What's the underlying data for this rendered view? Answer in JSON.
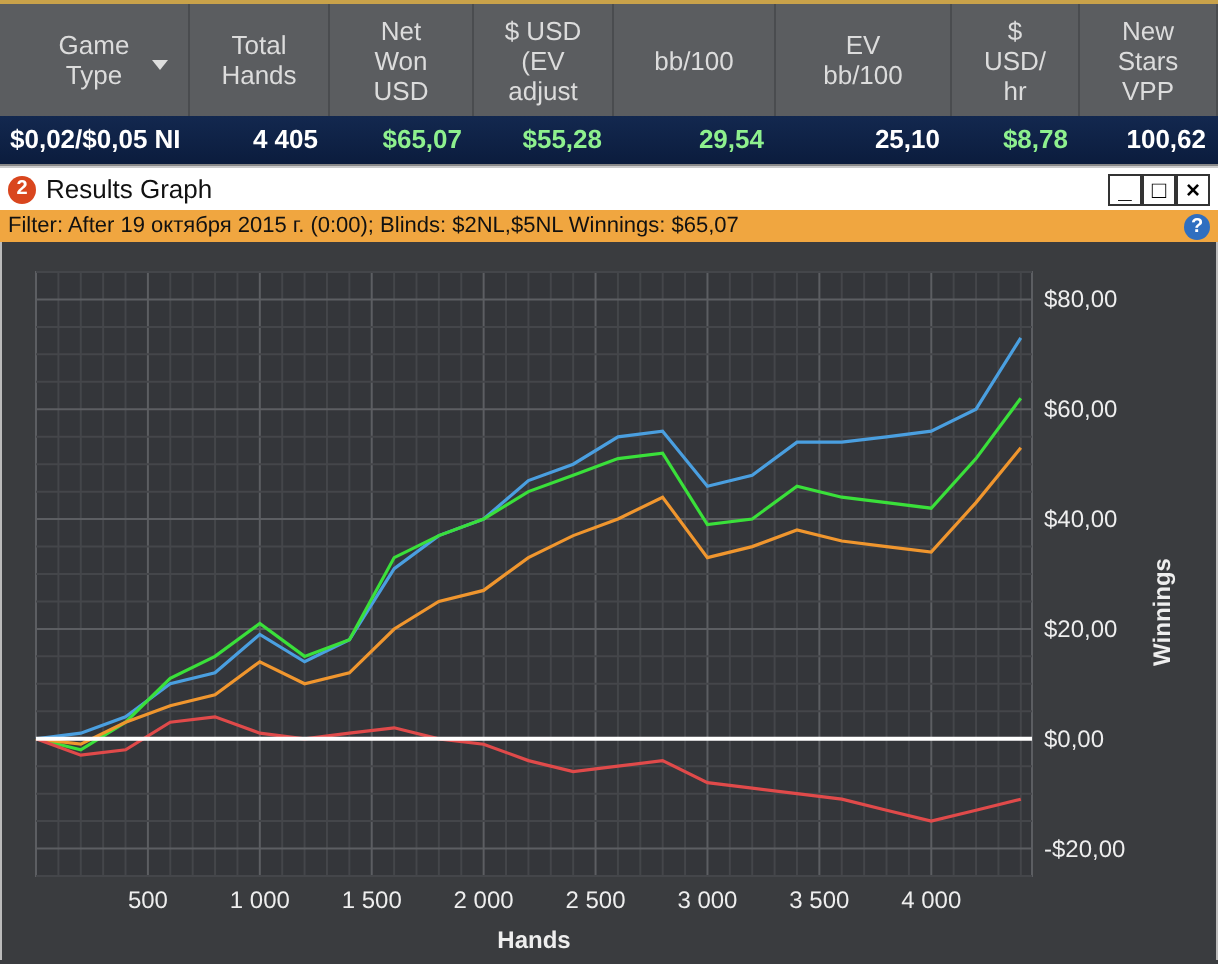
{
  "table": {
    "columns": [
      {
        "label": "Game\nType",
        "sort": true
      },
      {
        "label": "Total\nHands"
      },
      {
        "label": "Net\nWon\nUSD"
      },
      {
        "label": "$ USD\n(EV\nadjust"
      },
      {
        "label": "bb/100"
      },
      {
        "label": "EV\nbb/100"
      },
      {
        "label": "$\nUSD/\nhr"
      },
      {
        "label": "New\nStars\nVPP"
      }
    ],
    "rows": [
      {
        "cells": [
          {
            "text": "$0,02/$0,05 NI",
            "highlight": false
          },
          {
            "text": "4 405",
            "highlight": false
          },
          {
            "text": "$65,07",
            "highlight": true
          },
          {
            "text": "$55,28",
            "highlight": true
          },
          {
            "text": "29,54",
            "highlight": true
          },
          {
            "text": "25,10",
            "highlight": false
          },
          {
            "text": "$8,78",
            "highlight": true
          },
          {
            "text": "100,62",
            "highlight": false
          }
        ]
      }
    ]
  },
  "window": {
    "badge": "2",
    "title": "Results Graph",
    "controls": [
      "_",
      "□",
      "×"
    ],
    "filter": "Filter: After 19 октября 2015 г. (0:00); Blinds: $2NL,$5NL Winnings: $65,07",
    "help": "?",
    "chart_data": {
      "type": "line",
      "xlabel": "Hands",
      "ylabel": "Winnings",
      "x": [
        0,
        200,
        400,
        600,
        800,
        1000,
        1200,
        1400,
        1600,
        1800,
        2000,
        2200,
        2400,
        2600,
        2800,
        3000,
        3200,
        3400,
        3600,
        3800,
        4000,
        4200,
        4400
      ],
      "series": [
        {
          "color": "#4a9fe0",
          "values": [
            0,
            1,
            4,
            10,
            12,
            19,
            14,
            18,
            31,
            37,
            40,
            47,
            50,
            55,
            56,
            46,
            48,
            54,
            54,
            55,
            56,
            60,
            73
          ]
        },
        {
          "color": "#3ae03a",
          "values": [
            0,
            -2,
            3,
            11,
            15,
            21,
            15,
            18,
            33,
            37,
            40,
            45,
            48,
            51,
            52,
            39,
            40,
            46,
            44,
            43,
            42,
            51,
            62
          ]
        },
        {
          "color": "#f0962e",
          "values": [
            0,
            -1,
            3,
            6,
            8,
            14,
            10,
            12,
            20,
            25,
            27,
            33,
            37,
            40,
            44,
            33,
            35,
            38,
            36,
            35,
            34,
            43,
            53
          ]
        },
        {
          "color": "#e04a4a",
          "values": [
            0,
            -3,
            -2,
            3,
            4,
            1,
            0,
            1,
            2,
            0,
            -1,
            -4,
            -6,
            -5,
            -4,
            -8,
            -9,
            -10,
            -11,
            -13,
            -15,
            -13,
            -11
          ]
        }
      ],
      "grid": true,
      "xlim": [
        0,
        4450
      ],
      "ylim": [
        -25,
        85
      ],
      "xticks": [
        {
          "value": 500,
          "label": "500"
        },
        {
          "value": 1000,
          "label": "1 000"
        },
        {
          "value": 1500,
          "label": "1 500"
        },
        {
          "value": 2000,
          "label": "2 000"
        },
        {
          "value": 2500,
          "label": "2 500"
        },
        {
          "value": 3000,
          "label": "3 000"
        },
        {
          "value": 3500,
          "label": "3 500"
        },
        {
          "value": 4000,
          "label": "4 000"
        }
      ],
      "yticks": [
        {
          "value": -20,
          "label": "-$20,00"
        },
        {
          "value": 0,
          "label": "$0,00"
        },
        {
          "value": 20,
          "label": "$20,00"
        },
        {
          "value": 40,
          "label": "$40,00"
        },
        {
          "value": 60,
          "label": "$60,00"
        },
        {
          "value": 80,
          "label": "$80,00"
        }
      ]
    }
  }
}
